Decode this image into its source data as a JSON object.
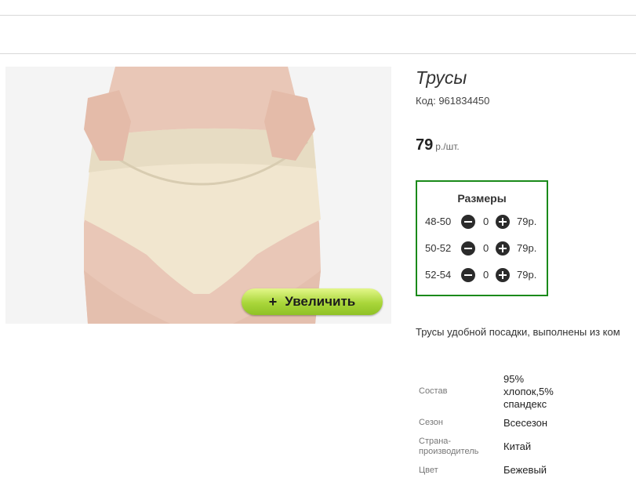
{
  "product": {
    "title": "Трусы",
    "code": "Код: 961834450",
    "price": "79",
    "price_unit": "р./шт.",
    "zoom_label": "Увеличить",
    "description": "Трусы удобной посадки, выполнены из ком"
  },
  "sizes": {
    "heading": "Размеры",
    "rows": [
      {
        "size": "48-50",
        "qty": "0",
        "price": "79р."
      },
      {
        "size": "50-52",
        "qty": "0",
        "price": "79р."
      },
      {
        "size": "52-54",
        "qty": "0",
        "price": "79р."
      }
    ]
  },
  "props": [
    {
      "label": "Состав",
      "value_lines": [
        "95%",
        "хлопок,5%",
        "спандекс"
      ]
    },
    {
      "label": "Сезон",
      "value_lines": [
        "Всесезон"
      ]
    },
    {
      "label_lines": [
        "Страна-",
        "производитель"
      ],
      "value_lines": [
        "Китай"
      ]
    },
    {
      "label": "Цвет",
      "value_lines": [
        "Бежевый"
      ]
    }
  ],
  "icons": {
    "minus": "minus-circle-icon",
    "plus": "plus-circle-icon"
  },
  "colors": {
    "sizes_border": "#1a8a1a",
    "zoom_button": "#a9d63a"
  }
}
